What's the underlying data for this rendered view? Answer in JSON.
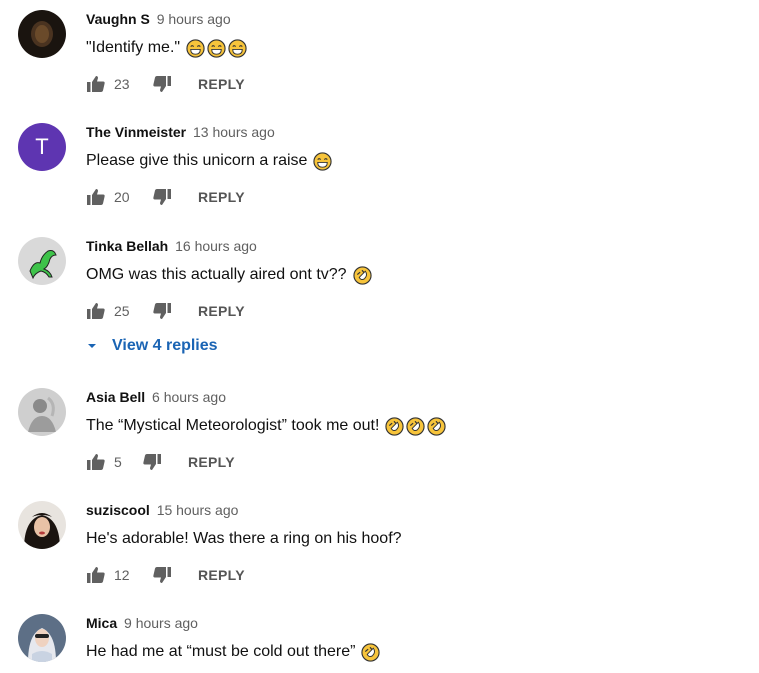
{
  "comments": [
    {
      "author": "Vaughn S",
      "time": "9 hours ago",
      "text": "\"Identify me.\"",
      "emojis": [
        "grinning-sweat",
        "grinning-sweat",
        "grinning-sweat"
      ],
      "likes": "23",
      "reply_label": "REPLY"
    },
    {
      "author": "The Vinmeister",
      "time": "13 hours ago",
      "text": "Please give this unicorn a raise",
      "emojis": [
        "grinning-sweat"
      ],
      "likes": "20",
      "reply_label": "REPLY",
      "avatar_letter": "T",
      "avatar_color": "#5e35b1"
    },
    {
      "author": "Tinka Bellah",
      "time": "16 hours ago",
      "text": "OMG was this actually aired ont tv??",
      "emojis": [
        "rofl"
      ],
      "likes": "25",
      "reply_label": "REPLY",
      "view_replies": "View 4 replies"
    },
    {
      "author": "Asia Bell",
      "time": "6 hours ago",
      "text": "The “Mystical Meteorologist” took me out!",
      "emojis": [
        "rofl",
        "rofl",
        "rofl"
      ],
      "likes": "5",
      "reply_label": "REPLY"
    },
    {
      "author": "suziscool",
      "time": "15 hours ago",
      "text": "He's adorable! Was there a ring on his hoof?",
      "emojis": [],
      "likes": "12",
      "reply_label": "REPLY"
    },
    {
      "author": "Mica",
      "time": "9 hours ago",
      "text": "He had me at “must be cold out there”",
      "emojis": [
        "rofl"
      ]
    }
  ],
  "colors": {
    "accent_link": "#1a64b4",
    "meta_gray": "#606060",
    "emoji_yellow": "#f7c43b"
  }
}
